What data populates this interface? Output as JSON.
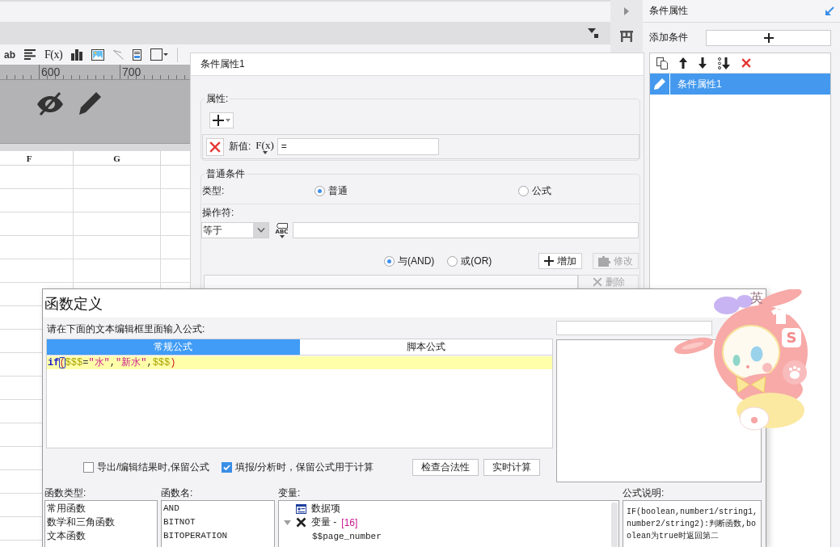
{
  "toolbar": {
    "text_style_button": "ab",
    "formula_button": "F(x)"
  },
  "ruler": {
    "labels": [
      "600",
      "700"
    ]
  },
  "sheet": {
    "columns": [
      "F",
      "G"
    ]
  },
  "side_panel": {
    "title": "条件属性",
    "add_label": "添加条件",
    "conditions": [
      {
        "label": "条件属性1",
        "selected": true
      }
    ]
  },
  "condition_dialog": {
    "title": "条件属性1",
    "properties": {
      "label": "属性:",
      "rows": [
        {
          "label": "新值:",
          "formula_button": "F(x)",
          "value": "="
        }
      ]
    },
    "normal_condition": {
      "label": "普通条件",
      "type_label": "类型:",
      "types": [
        {
          "label": "普通",
          "selected": true
        },
        {
          "label": "公式",
          "selected": false
        }
      ],
      "operator_label": "操作符:",
      "operator": "等于",
      "value_type_button": "ABC",
      "logic": [
        {
          "label": "与(AND)",
          "selected": true
        },
        {
          "label": "或(OR)",
          "selected": false
        }
      ],
      "buttons": [
        {
          "kind": "add",
          "label": "增加",
          "disabled": false
        },
        {
          "kind": "edit",
          "label": "修改",
          "disabled": true
        }
      ],
      "delete_button": {
        "label": "删除",
        "disabled": true
      }
    }
  },
  "formula_dialog": {
    "title": "函数定义",
    "prompt": "请在下面的文本编辑框里面输入公式:",
    "tabs": [
      {
        "label": "常规公式",
        "selected": true
      },
      {
        "label": "脚本公式",
        "selected": false
      }
    ],
    "code": [
      {
        "kind": "keyword",
        "text": "if"
      },
      {
        "kind": "matched_bracket",
        "text": "("
      },
      {
        "kind": "variable",
        "text": "$$$"
      },
      {
        "kind": "operator",
        "text": "="
      },
      {
        "kind": "string",
        "text": "\"水\""
      },
      {
        "kind": "operator",
        "text": ","
      },
      {
        "kind": "string",
        "text": "\"新水\""
      },
      {
        "kind": "operator",
        "text": ","
      },
      {
        "kind": "variable",
        "text": "$$$"
      },
      {
        "kind": "bracket",
        "text": ")"
      }
    ],
    "options": [
      {
        "label": "导出/编辑结果时,保留公式",
        "checked": false
      },
      {
        "label": "填报/分析时，保留公式用于计算",
        "checked": true
      }
    ],
    "buttons": [
      "检查合法性",
      "实时计算"
    ],
    "function_types": {
      "label": "函数类型:",
      "items": [
        {
          "label": "常用函数",
          "selected": false
        },
        {
          "label": "数学和三角函数",
          "selected": false
        },
        {
          "label": "文本函数",
          "selected": false
        }
      ]
    },
    "function_names": {
      "label": "函数名:",
      "items": [
        {
          "label": "AND",
          "selected": false
        },
        {
          "label": "BITNOT",
          "selected": false
        },
        {
          "label": "BITOPERATION",
          "selected": false
        }
      ]
    },
    "variables": {
      "label": "变量:",
      "tree": [
        {
          "kind": "data",
          "label": "数据项"
        },
        {
          "kind": "group",
          "label": "变量 -",
          "count": "[16]",
          "expanded": true,
          "children": [
            {
              "kind": "item",
              "label": "$$page_number"
            }
          ]
        }
      ]
    },
    "description": {
      "label": "公式说明:",
      "text": "IF(boolean,number1/string1,number2/string2):判断函数,boolean为true时返回第二"
    }
  },
  "input_method": {
    "mode": "英",
    "logo": "S"
  }
}
